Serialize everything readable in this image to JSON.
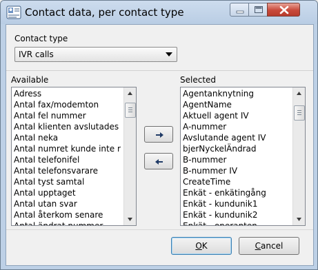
{
  "window": {
    "title": "Contact data, per contact type"
  },
  "contact_type": {
    "label": "Contact type",
    "value": "IVR calls"
  },
  "available": {
    "label": "Available",
    "items": [
      "Adress",
      "Antal fax/modemton",
      "Antal fel nummer",
      "Antal klienten avslutades",
      "Antal neka",
      "Antal numret kunde inte rin",
      "Antal telefonifel",
      "Antal telefonsvarare",
      "Antal tyst samtal",
      "Antal upptaget",
      "Antal utan svar",
      "Antal återkom senare",
      "Antal ändrat nummer"
    ]
  },
  "selected": {
    "label": "Selected",
    "items": [
      "Agentanknytning",
      "AgentName",
      "Aktuell agent IV",
      "A-nummer",
      "Avslutande agent IV",
      "bjerNyckelÄndrad",
      "B-nummer",
      "B-nummer IV",
      "CreateTime",
      "Enkät - enkätingång",
      "Enkät - kundunik1",
      "Enkät - kundunik2",
      "Enkät - operanten"
    ]
  },
  "buttons": {
    "ok_prefix": "",
    "ok_mnemonic": "O",
    "ok_rest": "K",
    "cancel_mnemonic": "C",
    "cancel_rest": "ancel"
  },
  "icons": {
    "add": "arrow-right-icon",
    "remove": "arrow-left-icon",
    "dropdown": "chevron-down-icon"
  },
  "colors": {
    "titlebar": "#bdd0e6",
    "close_button": "#c8493a",
    "arrow": "#1f3a66"
  }
}
